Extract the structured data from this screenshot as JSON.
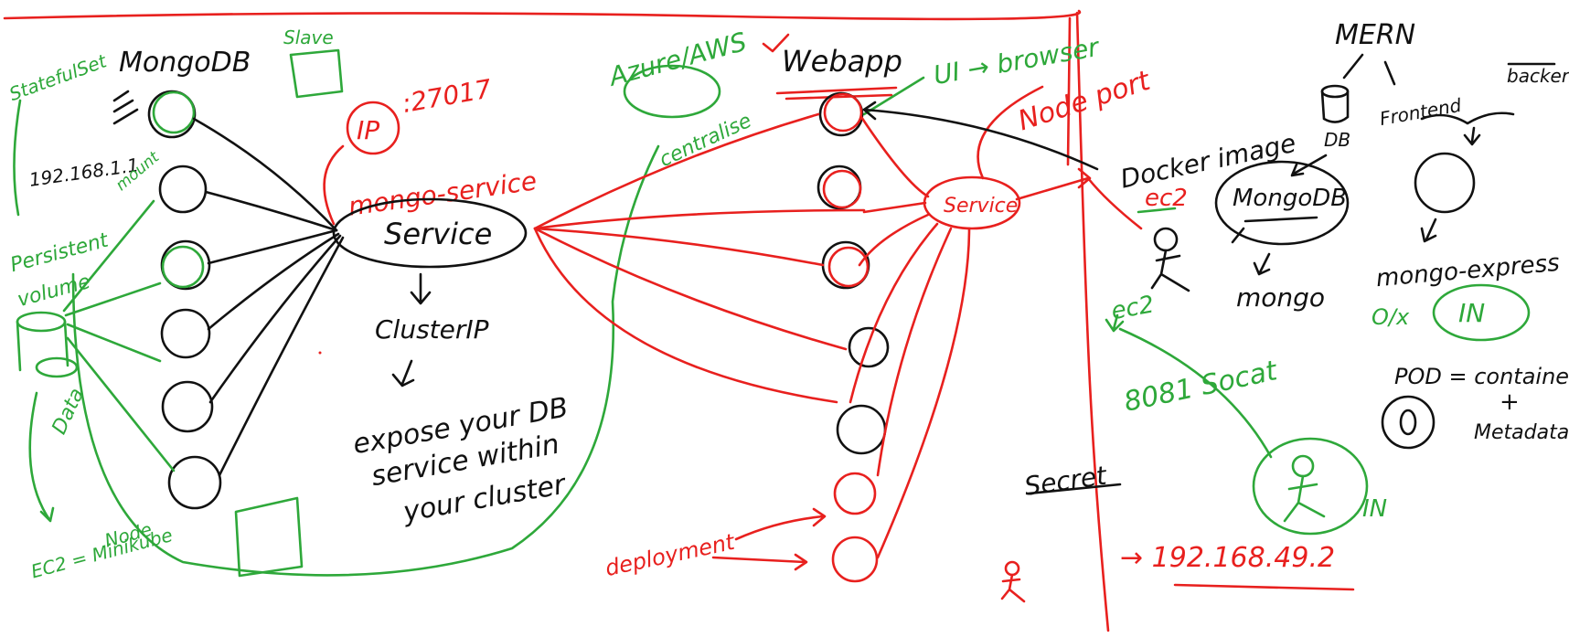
{
  "labels": {
    "mongodb": "MongoDB",
    "mongodb_right": "MongoDB",
    "service_left": "Service",
    "service_right": "Service",
    "cluster_ip": "ClusterIP",
    "expose_1": "expose your DB",
    "expose_2": "service within",
    "expose_3": "your cluster",
    "ip_label": "IP",
    "port_27017": ":27017",
    "mongo_service": "mongo-service",
    "webapp": "Webapp",
    "ui_browser": "UI → browser",
    "node_port": "Node port",
    "azure_aws": "Azure/AWS",
    "centralise": "centralise",
    "statefulset": "StatefulSet",
    "persistent_volume_1": "Persistent",
    "persistent_volume_2": "volume",
    "data": "Data",
    "ec2_minikube_1": "EC2 = Minikube",
    "ec2_minikube_2": "Node",
    "ip_addr_small": "192.168.1.1",
    "mount": "mount",
    "docker_image": "Docker image",
    "ec2_top": "ec2",
    "ec2_mid": "ec2",
    "mern": "MERN",
    "db": "DB",
    "frontend": "Frontend",
    "backend": "backend",
    "mongo": "mongo",
    "mongo_express": "mongo-express",
    "in_top": "IN",
    "in_bottom": "IN",
    "socat": "8081 Socat",
    "pod_eq": "POD = container",
    "plus": "+",
    "metadata": "Metadata",
    "secret": "Secret",
    "ip_addr_red": "→ 192.168.49.2",
    "deployment": "deployment",
    "slash": "Slave"
  }
}
